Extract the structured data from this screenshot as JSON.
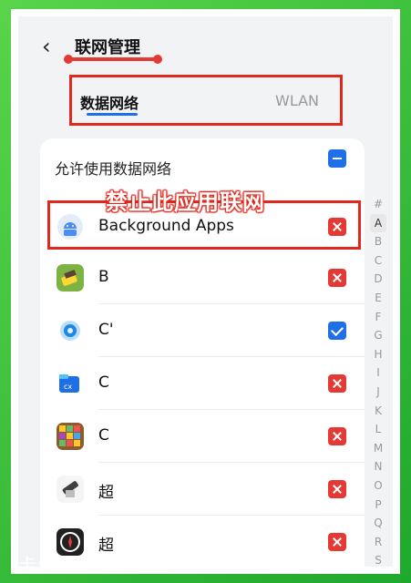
{
  "header": {
    "back_glyph": "‹",
    "title": "联网管理"
  },
  "tabs": [
    {
      "label": "数据网络",
      "active": true
    },
    {
      "label": "WLAN",
      "active": false
    }
  ],
  "allow_data": {
    "label": "允许使用数据网络",
    "state": "indeterminate"
  },
  "annotation": "禁止此应用联网",
  "apps": [
    {
      "label": "Background Apps",
      "icon": "android-icon",
      "state": "blocked"
    },
    {
      "label": "B",
      "icon": "box-app-icon",
      "state": "blocked"
    },
    {
      "label": "C'",
      "icon": "browser-app-icon",
      "state": "allowed"
    },
    {
      "label": "C",
      "icon": "cx-app-icon",
      "state": "blocked"
    },
    {
      "label": "C",
      "icon": "game-app-icon",
      "state": "blocked"
    },
    {
      "label": "超",
      "icon": "tool-app-icon",
      "state": "blocked"
    },
    {
      "label": "超",
      "icon": "clock-app-icon",
      "state": "blocked"
    }
  ],
  "alphabet": [
    "#",
    "A",
    "B",
    "C",
    "D",
    "E",
    "F",
    "G",
    "H",
    "I",
    "J",
    "K",
    "L",
    "M",
    "N",
    "O",
    "P",
    "Q",
    "R",
    "S"
  ],
  "active_letter": "A",
  "watermark": "卡饭论坛",
  "colors": {
    "accent": "#1e6fe8",
    "blocked": "#e53935",
    "annotation": "#e0281e",
    "frame": "#2fbf3c"
  }
}
